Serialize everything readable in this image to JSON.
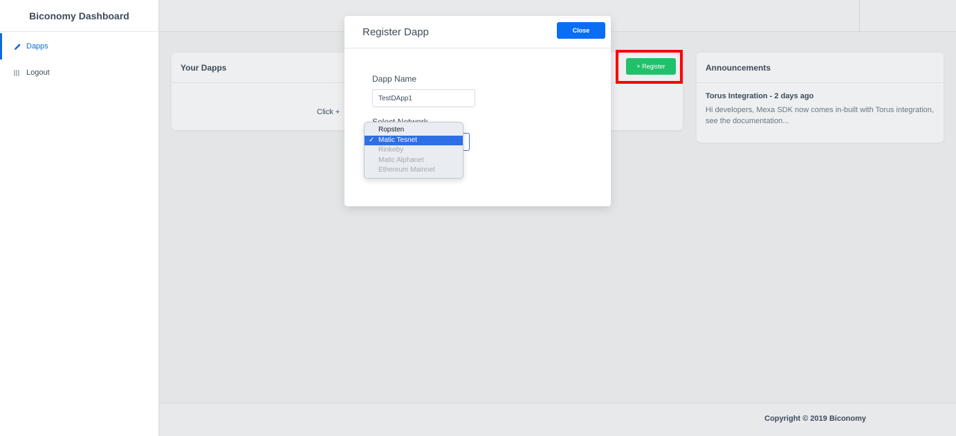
{
  "sidebar": {
    "brand": "Biconomy Dashboard",
    "items": [
      {
        "label": "Dapps",
        "icon": "pencil-icon"
      },
      {
        "label": "Logout",
        "icon": "list-icon"
      }
    ]
  },
  "dapps_card": {
    "title": "Your Dapps",
    "empty_text": "Click +"
  },
  "register_button": "+ Register",
  "announcements": {
    "title": "Announcements",
    "item_title": "Torus Integration - 2 days ago",
    "item_text": "Hi developers, Mexa SDK now comes in-built with Torus integration, see the documentation..."
  },
  "footer": {
    "copyright": "Copyright © 2019 Biconomy"
  },
  "modal": {
    "title": "Register Dapp",
    "close_label": "Close",
    "dapp_name_label": "Dapp Name",
    "dapp_name_value": "TestDApp1",
    "network_label": "Select Network"
  },
  "network_dropdown": {
    "options": [
      "Ropsten",
      "Matic Tesnet",
      "Rinkeby",
      "Matic Alphanet",
      "Ethereum Mainnet"
    ],
    "selected": "Matic Tesnet"
  },
  "colors": {
    "accent": "#0e6ad9",
    "register_green": "#21c16b",
    "close_blue": "#0a6ef5",
    "highlight_red": "#ff0000",
    "selected_option": "#2e6ee6"
  }
}
